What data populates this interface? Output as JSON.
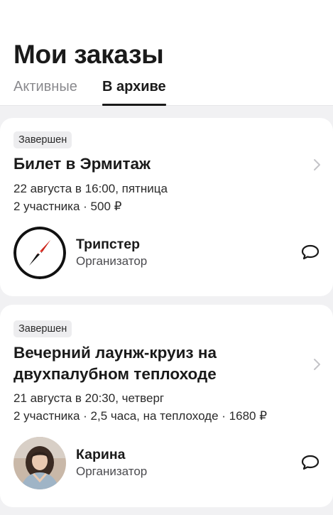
{
  "page": {
    "title": "Мои заказы"
  },
  "tabs": [
    {
      "label": "Активные",
      "active": false
    },
    {
      "label": "В архиве",
      "active": true
    }
  ],
  "orders": [
    {
      "status": "Завершен",
      "title": "Билет в Эрмитаж",
      "datetime": "22 августа в 16:00, пятница",
      "details": "2 участника · 500 ₽",
      "organizer": {
        "name": "Трипстер",
        "role": "Организатор",
        "avatar": "compass-logo"
      }
    },
    {
      "status": "Завершен",
      "title": "Вечерний лаунж-круиз на двухпалубном теплоходе",
      "datetime": "21 августа в 20:30, четверг",
      "details": "2 участника · 2,5 часа, на теплоходе · 1680 ₽",
      "organizer": {
        "name": "Карина",
        "role": "Организатор",
        "avatar": "person-photo"
      }
    }
  ],
  "colors": {
    "background": "#f1f1f3",
    "card": "#ffffff",
    "badge": "#ededef",
    "text": "#1a1a1a",
    "muted": "#8a8a8e",
    "compass_red": "#f03a2e"
  },
  "icons": {
    "chevron": "chevron-right-icon",
    "chat": "chat-bubble-icon"
  }
}
